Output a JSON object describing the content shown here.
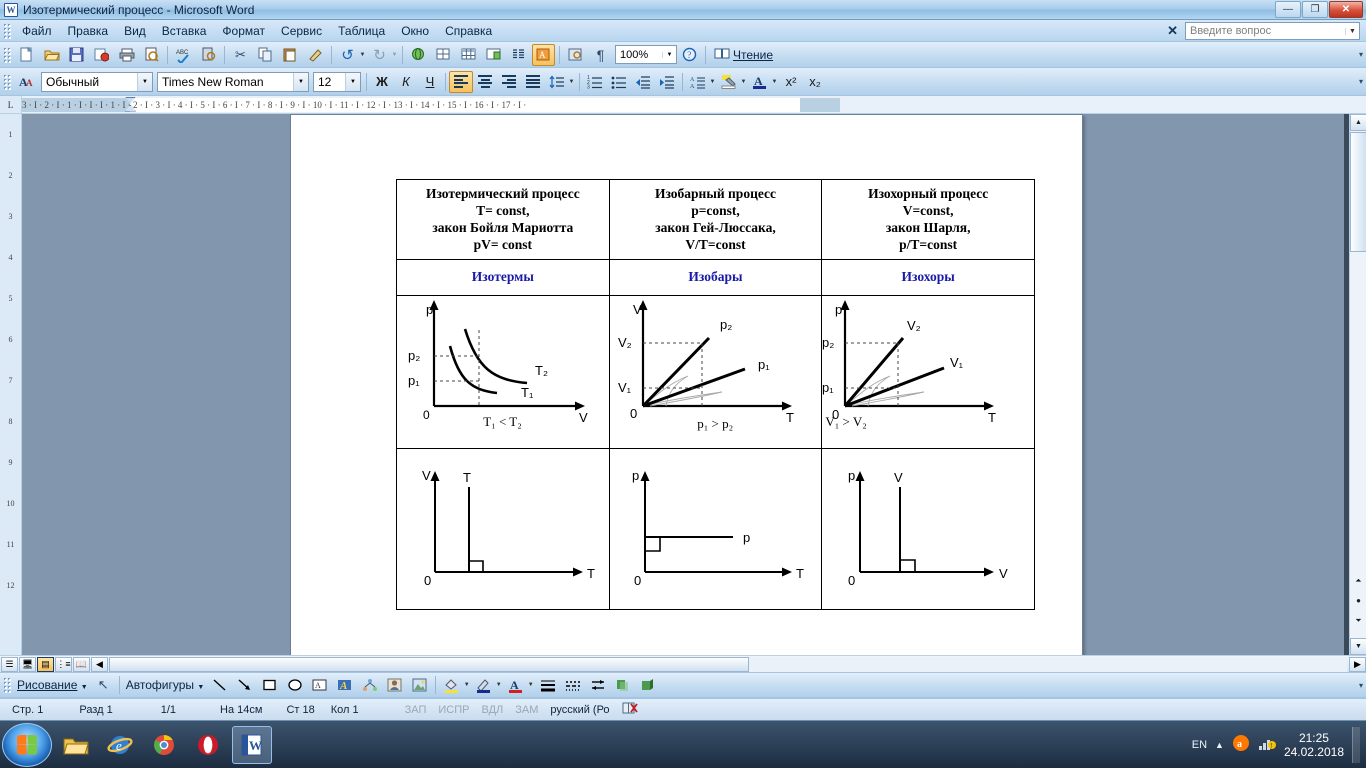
{
  "window": {
    "title": "Изотермический процесс - Microsoft Word",
    "app_icon": "word-icon",
    "minimize": "—",
    "restore": "❐",
    "close": "✕"
  },
  "menu": {
    "items": [
      "Файл",
      "Правка",
      "Вид",
      "Вставка",
      "Формат",
      "Сервис",
      "Таблица",
      "Окно",
      "Справка"
    ],
    "ask_placeholder": "Введите вопрос",
    "ask_value": ""
  },
  "toolbar_standard": {
    "buttons": [
      {
        "name": "new-document-icon",
        "glyph": "🗋"
      },
      {
        "name": "open-folder-icon",
        "glyph": "📂"
      },
      {
        "name": "save-icon",
        "glyph": "💾"
      },
      {
        "name": "mail-recipient-icon",
        "glyph": "✉"
      },
      {
        "name": "print-icon",
        "glyph": "🖨"
      },
      {
        "name": "print-preview-icon",
        "glyph": "🔎"
      },
      {
        "name": "spelling-check-icon",
        "glyph": "ABC"
      },
      {
        "name": "research-icon",
        "glyph": "📖"
      },
      {
        "name": "cut-icon",
        "glyph": "✂"
      },
      {
        "name": "copy-icon",
        "glyph": "📄"
      },
      {
        "name": "paste-icon",
        "glyph": "📋"
      },
      {
        "name": "format-painter-icon",
        "glyph": "🖌"
      },
      {
        "name": "undo-icon",
        "glyph": "↺"
      },
      {
        "name": "redo-icon",
        "glyph": "↻"
      },
      {
        "name": "insert-hyperlink-icon",
        "glyph": "🌐"
      },
      {
        "name": "tables-and-borders-icon",
        "glyph": "▦"
      },
      {
        "name": "insert-table-icon",
        "glyph": "⊞"
      },
      {
        "name": "insert-excel-sheet-icon",
        "glyph": "▤"
      },
      {
        "name": "columns-icon",
        "glyph": "☰"
      },
      {
        "name": "drawing-toggle-icon",
        "glyph": "🖊"
      },
      {
        "name": "document-map-icon",
        "glyph": "🗺"
      },
      {
        "name": "show-formatting-marks-icon",
        "glyph": "¶"
      }
    ],
    "zoom_value": "100%",
    "help_icon": "help-icon",
    "reading_label": "Чтение",
    "reading_icon": "book-icon"
  },
  "toolbar_formatting": {
    "styles_icon": "styles-and-formatting-icon",
    "style_value": "Обычный",
    "font_value": "Times New Roman",
    "size_value": "12",
    "bold": "Ж",
    "italic": "К",
    "underline": "Ч",
    "align_left": "align-left-icon",
    "align_center": "align-center-icon",
    "align_right": "align-right-icon",
    "align_justify": "align-justify-icon",
    "line_spacing": "line-spacing-icon",
    "numbering": "numbered-list-icon",
    "bullets": "bulleted-list-icon",
    "decrease_indent": "decrease-indent-icon",
    "increase_indent": "increase-indent-icon",
    "borders": "outside-border-icon",
    "highlight": "highlight-icon",
    "font_color": "font-color-icon",
    "superscript": "x²",
    "subscript": "x₂"
  },
  "ruler": {
    "corner_label": "L",
    "marks": "3 · I · 2 · I · 1 · I · I        ·  I  ·  1  ·  I  ·  2  ·  I  ·  3  ·  I  ·  4  ·  I  ·  5  ·  I  ·  6  ·  I  ·  7  ·  I  ·  8  ·  I  ·  9  ·  I  ·  10 ·  I  ·  11 ·  I  ·  12 ·  I  ·  13 ·  I  ·  14 ·  I  ·  15 ·  I  ·  16 ·  I  ·  17 ·  I  ·",
    "vertical_marks": [
      "1",
      "2",
      "3",
      "4",
      "5",
      "6",
      "7",
      "8",
      "9",
      "10",
      "11",
      "12"
    ]
  },
  "document": {
    "table": {
      "headers": [
        {
          "title": "Изотермический процесс",
          "lines": [
            "T= const,",
            "закон Бойля Мариотта",
            "pV= const"
          ]
        },
        {
          "title": "Изобарный процесс",
          "lines": [
            "p=const,",
            "закон Гей-Люссака,",
            "V/T=const"
          ]
        },
        {
          "title": "Изохорный процесс",
          "lines": [
            "V=const,",
            "закон Шарля,",
            "p/T=const"
          ]
        }
      ],
      "names": [
        "Изотермы",
        "Изобары",
        "Изохоры"
      ],
      "name_color": "#1a1aa8",
      "graphs_row1": [
        {
          "y_axis": "p",
          "x_axis": "V",
          "origin": "0",
          "tick_labels": [
            "p₂",
            "p₁"
          ],
          "curve_labels": [
            "T₂",
            "T₁"
          ],
          "caption": "T₁ <  T₂",
          "kind": "isotherm-hyperbolas"
        },
        {
          "y_axis": "V",
          "x_axis": "T",
          "origin": "0",
          "tick_labels": [
            "V₂",
            "V₁"
          ],
          "curve_labels": [
            "p₂",
            "p₁"
          ],
          "caption": "p₁ > p₂",
          "kind": "isobar-lines"
        },
        {
          "y_axis": "p",
          "x_axis": "T",
          "origin": "0",
          "tick_labels": [
            "p₂",
            "p₁"
          ],
          "curve_labels": [
            "V₂",
            "V₁"
          ],
          "caption": "V₁ > V₂",
          "kind": "isochor-lines"
        }
      ],
      "graphs_row2": [
        {
          "y_axis": "V",
          "x_axis": "T",
          "origin": "0",
          "line_label": "T",
          "kind": "vertical-line"
        },
        {
          "y_axis": "p",
          "x_axis": "T",
          "origin": "0",
          "line_label": "p",
          "kind": "horizontal-line"
        },
        {
          "y_axis": "p",
          "x_axis": "V",
          "origin": "0",
          "line_label": "V",
          "kind": "vertical-line"
        }
      ]
    }
  },
  "drawing_toolbar": {
    "menu_label": "Рисование",
    "autoshapes_label": "Автофигуры",
    "buttons": [
      {
        "name": "select-objects-icon",
        "glyph": "↖"
      },
      {
        "name": "line-icon",
        "glyph": "╲"
      },
      {
        "name": "arrow-icon",
        "glyph": "↘"
      },
      {
        "name": "rectangle-icon",
        "glyph": "▭"
      },
      {
        "name": "oval-icon",
        "glyph": "◯"
      },
      {
        "name": "text-box-icon",
        "glyph": "▤"
      },
      {
        "name": "wordart-icon",
        "glyph": "A"
      },
      {
        "name": "diagram-icon",
        "glyph": "⁂"
      },
      {
        "name": "clip-art-icon",
        "glyph": "👤"
      },
      {
        "name": "insert-picture-icon",
        "glyph": "🖼"
      },
      {
        "name": "fill-color-icon",
        "glyph": "🪣"
      },
      {
        "name": "line-color-icon",
        "glyph": "🖌"
      },
      {
        "name": "font-color-icon",
        "glyph": "A"
      },
      {
        "name": "line-style-icon",
        "glyph": "☰"
      },
      {
        "name": "dash-style-icon",
        "glyph": "┄"
      },
      {
        "name": "arrow-style-icon",
        "glyph": "⇄"
      },
      {
        "name": "shadow-style-icon",
        "glyph": "▮"
      },
      {
        "name": "3d-style-icon",
        "glyph": "▰"
      }
    ]
  },
  "status_bar": {
    "page": "Стр. 1",
    "section": "Разд 1",
    "pages": "1/1",
    "position": "На 14см",
    "line": "Ст 18",
    "column": "Кол 1",
    "rec": "ЗАП",
    "trk": "ИСПР",
    "ext": "ВДЛ",
    "ovr": "ЗАМ",
    "language": "русский (Ро",
    "spell_icon": "spell-check-status-icon"
  },
  "taskbar": {
    "start": "start-orb",
    "items": [
      {
        "name": "taskbar-windows-explorer",
        "glyph": "📁",
        "active": false
      },
      {
        "name": "taskbar-internet-explorer",
        "glyph": "e",
        "active": false
      },
      {
        "name": "taskbar-google-chrome",
        "glyph": "◉",
        "active": false
      },
      {
        "name": "taskbar-opera",
        "glyph": "O",
        "active": false
      },
      {
        "name": "taskbar-microsoft-word",
        "glyph": "W",
        "active": true
      }
    ],
    "tray": {
      "show_hidden": "▲",
      "avast_icon": "avast-icon",
      "network_icon": "network-icon",
      "language": "EN",
      "time": "21:25",
      "date": "24.02.2018"
    }
  }
}
